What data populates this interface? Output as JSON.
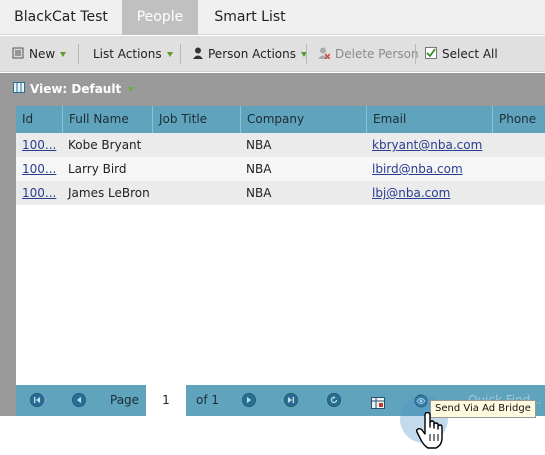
{
  "tabs": [
    {
      "label": "BlackCat Test"
    },
    {
      "label": "People"
    },
    {
      "label": "Smart List"
    }
  ],
  "toolbar": {
    "new_label": "New",
    "list_actions_label": "List Actions",
    "person_actions_label": "Person Actions",
    "delete_person_label": "Delete Person",
    "select_all_label": "Select All"
  },
  "view": {
    "label": "View: Default"
  },
  "grid": {
    "columns": [
      "Id",
      "Full Name",
      "Job Title",
      "Company",
      "Email",
      "Phone"
    ],
    "rows": [
      {
        "id": "100...",
        "full_name": "Kobe Bryant",
        "job_title": "",
        "company": "NBA",
        "email": "kbryant@nba.com",
        "phone": ""
      },
      {
        "id": "100...",
        "full_name": "Larry Bird",
        "job_title": "",
        "company": "NBA",
        "email": "lbird@nba.com",
        "phone": ""
      },
      {
        "id": "100...",
        "full_name": "James LeBron",
        "job_title": "",
        "company": "NBA",
        "email": "lbj@nba.com",
        "phone": ""
      }
    ]
  },
  "pager": {
    "page_label": "Page",
    "page_value": "1",
    "of_label": "of 1",
    "quick_find_placeholder": "Quick Find..."
  },
  "tooltip": {
    "text": "Send Via Ad Bridge"
  },
  "colors": {
    "header_blue": "#5fa3bd",
    "active_tab": "#c0c0c0",
    "link": "#2a3d8f"
  }
}
